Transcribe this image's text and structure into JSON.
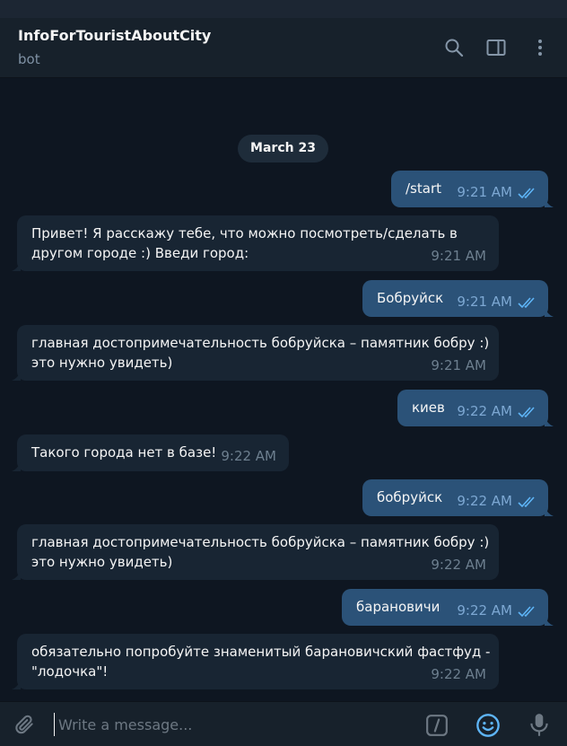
{
  "header": {
    "title": "InfoForTouristAboutCity",
    "subtitle": "bot"
  },
  "date_separator": "March 23",
  "messages": [
    {
      "dir": "out",
      "lines": [
        "/start"
      ],
      "time": "9:21 AM"
    },
    {
      "dir": "in",
      "lines": [
        "Привет! Я расскажу тебе, что можно посмотреть/сделать в",
        "другом городе :) Введи город:"
      ],
      "time": "9:21 AM"
    },
    {
      "dir": "out",
      "lines": [
        "Бобруйск"
      ],
      "time": "9:21 AM"
    },
    {
      "dir": "in",
      "lines": [
        "главная достопримечательность бобруйска – памятник бобру :)",
        "это нужно увидеть)"
      ],
      "time": "9:21 AM"
    },
    {
      "dir": "out",
      "lines": [
        "киев"
      ],
      "time": "9:22 AM"
    },
    {
      "dir": "in",
      "lines": [
        "Такого города нет в базе!"
      ],
      "time": "9:22 AM"
    },
    {
      "dir": "out",
      "lines": [
        "бобруйск"
      ],
      "time": "9:22 AM"
    },
    {
      "dir": "in",
      "lines": [
        "главная достопримечательность бобруйска – памятник бобру :)",
        "это нужно увидеть)"
      ],
      "time": "9:22 AM"
    },
    {
      "dir": "out",
      "lines": [
        "барановичи"
      ],
      "time": "9:22 AM"
    },
    {
      "dir": "in",
      "lines": [
        "обязательно попробуйте знаменитый барановичский фастфуд -",
        "\"лодочка\"!"
      ],
      "time": "9:22 AM"
    }
  ],
  "composer": {
    "placeholder": "Write a message..."
  },
  "colors": {
    "accent": "#5eb5f7",
    "outgoing": "#2b5278",
    "incoming": "#182533",
    "background": "#0e1621"
  }
}
